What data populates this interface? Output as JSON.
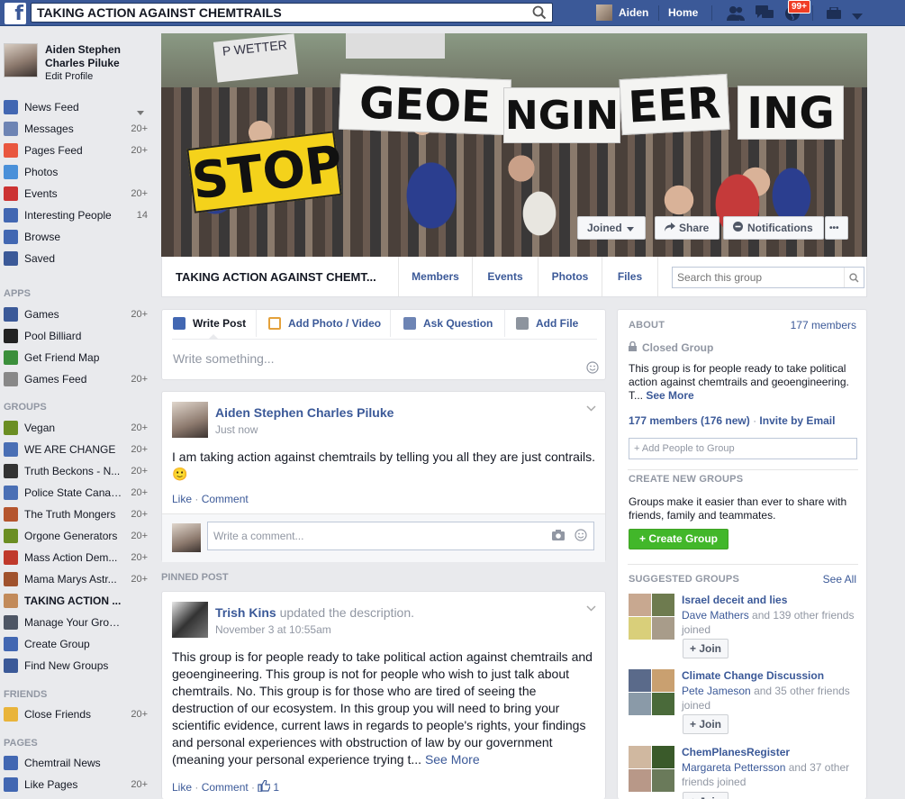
{
  "topbar": {
    "search_value": "TAKING ACTION AGAINST CHEMTRAILS",
    "user_name": "Aiden",
    "home_label": "Home",
    "notif_badge": "99+"
  },
  "profile": {
    "name": "Aiden Stephen Charles Piluke",
    "edit_label": "Edit Profile"
  },
  "nav": {
    "main": [
      {
        "label": "News Feed",
        "count": ""
      },
      {
        "label": "Messages",
        "count": "20+"
      },
      {
        "label": "Pages Feed",
        "count": "20+"
      },
      {
        "label": "Photos",
        "count": ""
      },
      {
        "label": "Events",
        "count": "20+"
      },
      {
        "label": "Interesting People",
        "count": "14"
      },
      {
        "label": "Browse",
        "count": ""
      },
      {
        "label": "Saved",
        "count": ""
      }
    ],
    "apps_heading": "APPS",
    "apps": [
      {
        "label": "Games",
        "count": "20+"
      },
      {
        "label": "Pool Billiard",
        "count": ""
      },
      {
        "label": "Get Friend Map",
        "count": ""
      },
      {
        "label": "Games Feed",
        "count": "20+"
      }
    ],
    "groups_heading": "GROUPS",
    "groups": [
      {
        "label": "Vegan",
        "count": "20+"
      },
      {
        "label": "WE ARE CHANGE",
        "count": "20+"
      },
      {
        "label": "Truth Beckons - N...",
        "count": "20+"
      },
      {
        "label": "Police State Canada",
        "count": "20+"
      },
      {
        "label": "The Truth Mongers",
        "count": "20+"
      },
      {
        "label": "Orgone Generators",
        "count": "20+"
      },
      {
        "label": "Mass Action Dem...",
        "count": "20+"
      },
      {
        "label": "Mama Marys Astr...",
        "count": "20+"
      },
      {
        "label": "TAKING ACTION ...",
        "count": ""
      },
      {
        "label": "Manage Your Groups",
        "count": ""
      },
      {
        "label": "Create Group",
        "count": ""
      },
      {
        "label": "Find New Groups",
        "count": ""
      }
    ],
    "friends_heading": "FRIENDS",
    "friends": [
      {
        "label": "Close Friends",
        "count": "20+"
      }
    ],
    "pages_heading": "PAGES",
    "pages": [
      {
        "label": "Chemtrail News",
        "count": ""
      },
      {
        "label": "Like Pages",
        "count": "20+"
      }
    ]
  },
  "cover": {
    "sign_words": [
      "GEOE",
      "NGIN",
      "EER",
      "ING"
    ],
    "stop_sign": "STOP",
    "banner_text": "P WETTER",
    "joined_label": "Joined",
    "share_label": "Share",
    "notifications_label": "Notifications",
    "more_label": "•••"
  },
  "group_bar": {
    "title": "TAKING ACTION AGAINST CHEMT...",
    "tabs": [
      "Members",
      "Events",
      "Photos",
      "Files"
    ],
    "search_placeholder": "Search this group"
  },
  "composer": {
    "tabs": [
      "Write Post",
      "Add Photo / Video",
      "Ask Question",
      "Add File"
    ],
    "placeholder": "Write something..."
  },
  "post1": {
    "author": "Aiden Stephen Charles Piluke",
    "time": "Just now",
    "text": "I am taking action against chemtrails by telling you all they are just contrails. 🙂",
    "like": "Like",
    "comment": "Comment",
    "comment_placeholder": "Write a comment..."
  },
  "pinned_label": "PINNED POST",
  "post2": {
    "author": "Trish Kins",
    "action": "updated the description.",
    "time": "November 3 at 10:55am",
    "text": "This group is for people ready to take political action against chemtrails and geoengineering. This group is not for people who wish to just talk about chemtrails. No. This group is for those who are tired of seeing the destruction of our ecosystem. In this group you will need to bring your scientific evidence, current laws in regards to people's rights, your findings and personal experiences with obstruction of law by our government (meaning your personal experience trying t...",
    "see_more": "See More",
    "like": "Like",
    "comment": "Comment",
    "likes_count": "1"
  },
  "about": {
    "heading": "ABOUT",
    "members_link": "177 members",
    "privacy": "Closed Group",
    "description": "This group is for people ready to take political action against chemtrails and geoengineering. T...",
    "see_more": "See More",
    "members_summary": "177 members (176 new)",
    "invite": "Invite by Email",
    "add_people_placeholder": "+ Add People to Group"
  },
  "create_groups": {
    "heading": "CREATE NEW GROUPS",
    "text": "Groups make it easier than ever to share with friends, family and teammates.",
    "button": "+ Create Group"
  },
  "suggested": {
    "heading": "SUGGESTED GROUPS",
    "see_all": "See All",
    "groups": [
      {
        "name": "Israel deceit and lies",
        "friend": "Dave Mathers",
        "rest": "and 139 other friends joined",
        "join": "+ Join"
      },
      {
        "name": "Climate Change Discussion",
        "friend": "Pete Jameson",
        "rest": "and 35 other friends joined",
        "join": "+ Join"
      },
      {
        "name": "ChemPlanesRegister",
        "friend": "Margareta Pettersson",
        "rest": "and 37 other friends joined",
        "join": "+ Join"
      }
    ]
  },
  "colors": {
    "brand_blue": "#3b5998",
    "green": "#42b72a",
    "badge_red": "#f03d25"
  }
}
